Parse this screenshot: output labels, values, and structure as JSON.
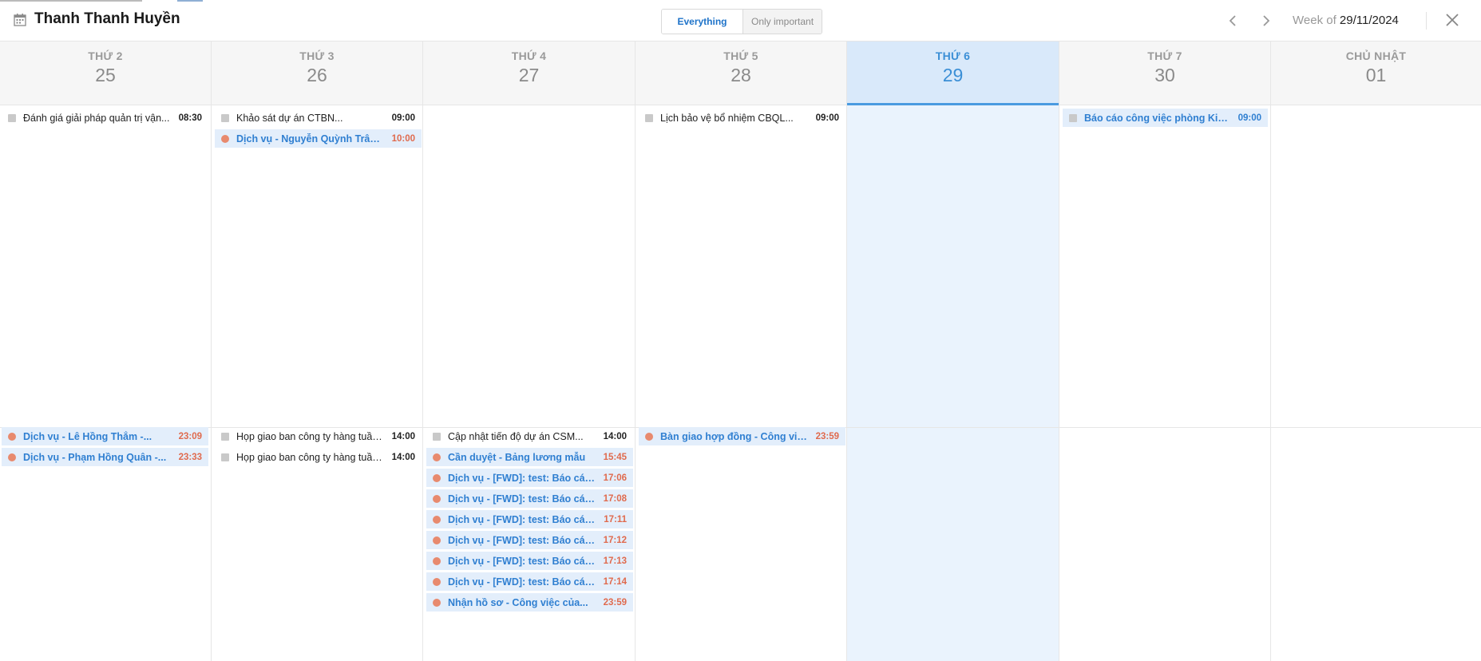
{
  "header": {
    "title": "Thanh Thanh Huyền",
    "filter_all": "Everything",
    "filter_important": "Only important",
    "week_prefix": "Week of",
    "week_date": "29/11/2024"
  },
  "colors": {
    "accent": "#1e73c9",
    "today_bg": "#eaf3fd",
    "event_highlight_bg": "#e3eefb",
    "status_dot": "#e88a6e",
    "time_alert": "#e06a4d"
  },
  "days": [
    {
      "dow": "THỨ 2",
      "num": "25",
      "today": false,
      "morning": [
        {
          "title": "Đánh giá giải pháp quản trị vận...",
          "time": "08:30",
          "style": "plain"
        }
      ],
      "afternoon": [
        {
          "title": "Dịch vụ - Lê Hồng Thắm -...",
          "time": "23:09",
          "style": "hl"
        },
        {
          "title": "Dịch vụ - Phạm Hồng Quân -...",
          "time": "23:33",
          "style": "hl"
        }
      ]
    },
    {
      "dow": "THỨ 3",
      "num": "26",
      "today": false,
      "morning": [
        {
          "title": "Khảo sát dự án CTBN...",
          "time": "09:00",
          "style": "plain"
        },
        {
          "title": "Dịch vụ - Nguyễn Quỳnh Trâm -...",
          "time": "10:00",
          "style": "hl"
        }
      ],
      "afternoon": [
        {
          "title": "Họp giao ban công ty hàng tuần...",
          "time": "14:00",
          "style": "plain"
        },
        {
          "title": "Họp giao ban công ty hàng tuần...",
          "time": "14:00",
          "style": "plain"
        }
      ]
    },
    {
      "dow": "THỨ 4",
      "num": "27",
      "today": false,
      "morning": [],
      "afternoon": [
        {
          "title": "Cập nhật tiến độ dự án CSM...",
          "time": "14:00",
          "style": "plain"
        },
        {
          "title": "Cần duyệt - Bảng lương mẫu",
          "time": "15:45",
          "style": "hl"
        },
        {
          "title": "Dịch vụ - [FWD]: test: Báo cáo...",
          "time": "17:06",
          "style": "hl"
        },
        {
          "title": "Dịch vụ - [FWD]: test: Báo cáo...",
          "time": "17:08",
          "style": "hl"
        },
        {
          "title": "Dịch vụ - [FWD]: test: Báo cáo...",
          "time": "17:11",
          "style": "hl"
        },
        {
          "title": "Dịch vụ - [FWD]: test: Báo cáo...",
          "time": "17:12",
          "style": "hl"
        },
        {
          "title": "Dịch vụ - [FWD]: test: Báo cáo...",
          "time": "17:13",
          "style": "hl"
        },
        {
          "title": "Dịch vụ - [FWD]: test: Báo cáo...",
          "time": "17:14",
          "style": "hl"
        },
        {
          "title": "Nhận hồ sơ - Công việc của...",
          "time": "23:59",
          "style": "hl"
        }
      ]
    },
    {
      "dow": "THỨ 5",
      "num": "28",
      "today": false,
      "morning": [
        {
          "title": "Lịch bảo vệ bổ nhiệm CBQL...",
          "time": "09:00",
          "style": "plain"
        }
      ],
      "afternoon": [
        {
          "title": "Bàn giao hợp đồng - Công việc...",
          "time": "23:59",
          "style": "hl"
        }
      ]
    },
    {
      "dow": "THỨ 6",
      "num": "29",
      "today": true,
      "morning": [],
      "afternoon": []
    },
    {
      "dow": "THỨ 7",
      "num": "30",
      "today": false,
      "morning": [
        {
          "title": "Báo cáo công việc phòng Kinh...",
          "time": "09:00",
          "style": "blue"
        }
      ],
      "afternoon": []
    },
    {
      "dow": "CHỦ NHẬT",
      "num": "01",
      "today": false,
      "morning": [],
      "afternoon": []
    }
  ]
}
